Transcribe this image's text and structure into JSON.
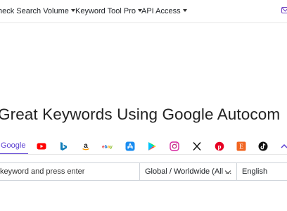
{
  "nav": {
    "items": [
      {
        "label": "heck Search Volume"
      },
      {
        "label": "Keyword Tool Pro"
      },
      {
        "label": "API Access"
      }
    ],
    "mail_icon": "envelope-icon"
  },
  "headline": "Great Keywords Using Google Autocom",
  "tabs": {
    "active_label": "Google",
    "icons": [
      "youtube-icon",
      "bing-icon",
      "amazon-icon",
      "ebay-icon",
      "app-store-icon",
      "play-store-icon",
      "instagram-icon",
      "x-icon",
      "pinterest-icon",
      "etsy-icon",
      "tiktok-icon",
      "more-icon"
    ],
    "accent": "#5b3fd1"
  },
  "search": {
    "placeholder": "keyword and press enter",
    "location": "Global / Worldwide (All ...",
    "language": "English"
  }
}
